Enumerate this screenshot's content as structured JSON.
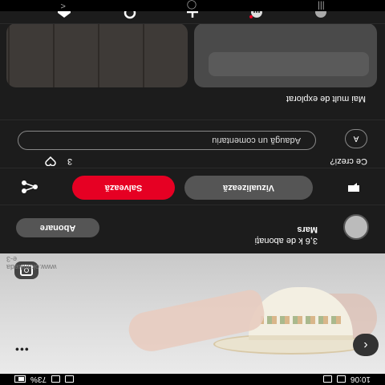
{
  "status_bar": {
    "time": "10:06",
    "battery": "73%"
  },
  "pin": {
    "watermark_line1": "www.okanikeda",
    "watermark_line2": "e-3"
  },
  "creator": {
    "name": "Mars",
    "followers": "3,6 k de abonați",
    "follow_label": "Abonare"
  },
  "actions": {
    "visualize_label": "Vizualizează",
    "save_label": "Salvează"
  },
  "comments": {
    "title": "Ce crezi?",
    "count": "3",
    "avatar_letter": "A",
    "input_placeholder": "Adaugă un comentariu"
  },
  "explore": {
    "title": "Mai mult de explorat"
  },
  "colors": {
    "accent_red": "#e60023",
    "background": "#1c1c1c",
    "button_gray": "#555555"
  }
}
